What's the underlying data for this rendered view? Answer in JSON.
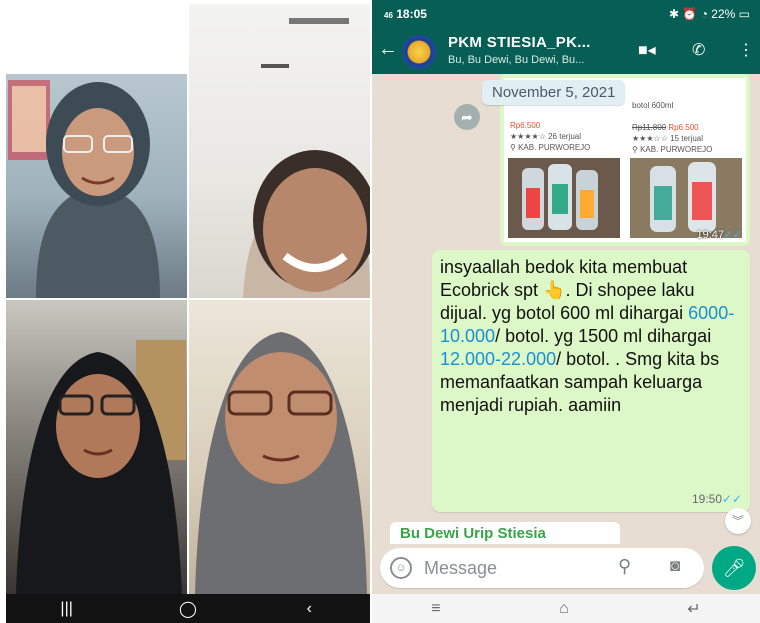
{
  "call": {
    "nav": {
      "recents": "|||",
      "home": "◯",
      "back": "‹"
    }
  },
  "whatsapp": {
    "status": {
      "time": "18:05",
      "indicators": "46",
      "battery": "22%"
    },
    "header": {
      "back": "←",
      "title": "PKM STIESIA_PK...",
      "subtitle": "Bu, Bu Dewi, Bu Dewi, Bu...",
      "video_icon": "video-icon",
      "call_icon": "phone-icon",
      "menu_icon": "more-icon"
    },
    "date_chip": "November 5, 2021",
    "image_message": {
      "time": "19:47",
      "card_left": {
        "price": "Rp6.500",
        "sold": "26 terjual",
        "location": "KAB. PURWOREJO"
      },
      "card_right": {
        "title": "botol 600ml",
        "old_price": "Rp11.800",
        "price": "Rp6.500",
        "sold": "15 terjual",
        "location": "KAB. PURWOREJO"
      }
    },
    "text_message": {
      "part1": "insyaallah bedok kita membuat Ecobrick spt ",
      "emoji": "👆",
      "part2": ".  Di shopee laku dijual.  yg botol 600 ml dihargai ",
      "link1": "6000-10.000",
      "part3": "/ botol. yg 1500 ml dihargai ",
      "link2": "12.000-22.000",
      "part4": "/ botol. . Smg kita bs memanfaatkan sampah keluarga menjadi rupiah. aamiin",
      "time": "19:50"
    },
    "next_sender": "Bu Dewi Urip Stiesia",
    "composer": {
      "placeholder": "Message"
    },
    "colors": {
      "header": "#075e54",
      "bubble": "#dcf8c6",
      "link": "#1a8fd6",
      "mic": "#00a884",
      "sender": "#3aa44a"
    }
  }
}
